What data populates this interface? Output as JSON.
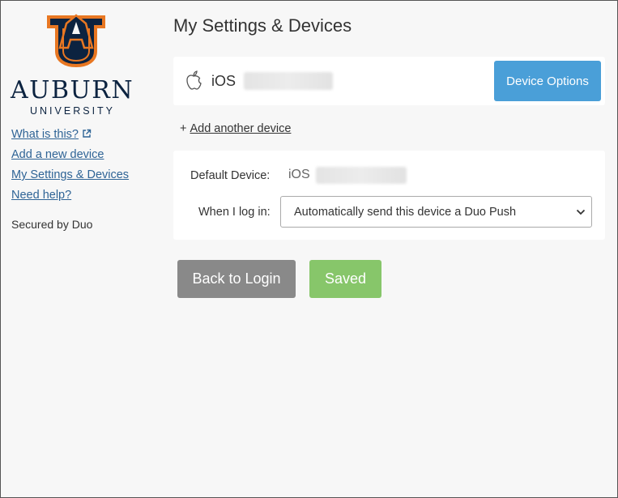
{
  "sidebar": {
    "brand_name": "AUBURN",
    "brand_sub": "UNIVERSITY",
    "links": [
      {
        "label": "What is this?"
      },
      {
        "label": "Add a new device"
      },
      {
        "label": "My Settings & Devices"
      },
      {
        "label": "Need help?"
      }
    ],
    "secured_by": "Secured by Duo"
  },
  "main": {
    "title": "My Settings & Devices",
    "device": {
      "os": "iOS",
      "options_label": "Device Options"
    },
    "add_device": {
      "plus": "+",
      "label": "Add another device"
    },
    "settings": {
      "default_device_label": "Default Device:",
      "default_device_value": "iOS",
      "login_label": "When I log in:",
      "login_selected": "Automatically send this device a Duo Push"
    },
    "buttons": {
      "back": "Back to Login",
      "saved": "Saved"
    }
  },
  "colors": {
    "brand_navy": "#0c2340",
    "brand_orange": "#e87722",
    "primary_blue": "#4a9fd8",
    "success_green": "#87c66a",
    "neutral_gray": "#898989",
    "link_blue": "#2f6496"
  }
}
